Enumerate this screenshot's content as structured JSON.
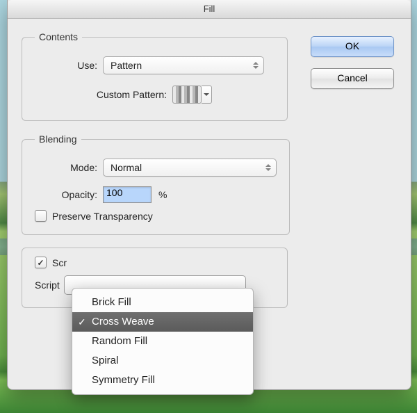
{
  "window": {
    "title": "Fill"
  },
  "buttons": {
    "ok": "OK",
    "cancel": "Cancel"
  },
  "contents": {
    "legend": "Contents",
    "use_label": "Use:",
    "use_value": "Pattern",
    "custom_pattern_label": "Custom Pattern:"
  },
  "blending": {
    "legend": "Blending",
    "mode_label": "Mode:",
    "mode_value": "Normal",
    "opacity_label": "Opacity:",
    "opacity_value": "100",
    "opacity_suffix": "%",
    "preserve_label": "Preserve Transparency",
    "preserve_checked": false
  },
  "scripted": {
    "checkbox_label_prefix": "Scr",
    "checkbox_checked": true,
    "script_label": "Script",
    "menu": {
      "selected_index": 1,
      "items": [
        "Brick Fill",
        "Cross Weave",
        "Random Fill",
        "Spiral",
        "Symmetry Fill"
      ]
    }
  }
}
